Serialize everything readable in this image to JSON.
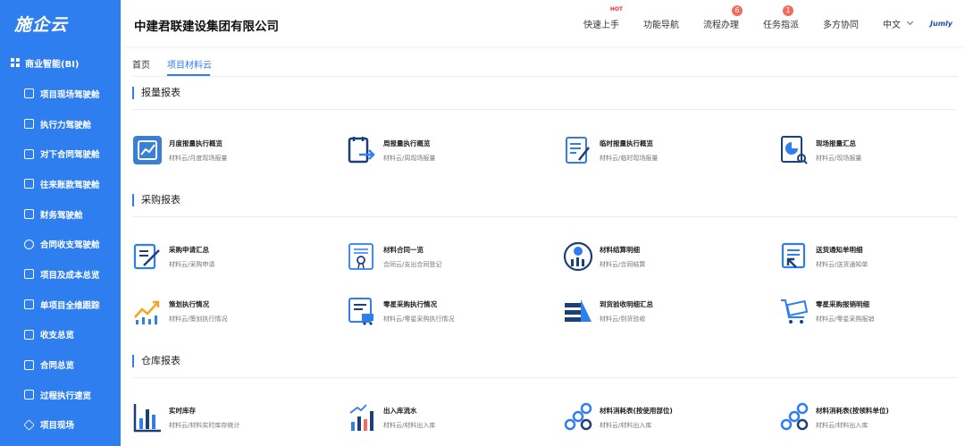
{
  "sidebar": {
    "logo": "施企云",
    "head": "商业智能(BI)",
    "items": [
      "项目现场驾驶舱",
      "执行力驾驶舱",
      "对下合同驾驶舱",
      "往来账款驾驶舱",
      "财务驾驶舱",
      "合同收支驾驶舱",
      "项目及成本总览",
      "单项目全维跟踪",
      "收支总览",
      "合同总览",
      "过程执行速览",
      "项目现场"
    ]
  },
  "header": {
    "company": "中建君联建设集团有限公司",
    "nav": {
      "quickstart": "快速上手",
      "quickstart_tag": "HOT",
      "funcnav": "功能导航",
      "process": "流程办理",
      "process_badge": "6",
      "task": "任务指派",
      "task_badge": "1",
      "collab": "多方协同",
      "lang": "中文",
      "brand": "Jumly"
    }
  },
  "tabs": [
    "首页",
    "项目材料云"
  ],
  "sections": [
    {
      "title": "报量报表",
      "cards": [
        {
          "title": "月度报量执行概览",
          "sub": "材料云/月度现场报量"
        },
        {
          "title": "周报量执行概览",
          "sub": "材料云/周现场报量"
        },
        {
          "title": "临时报量执行概览",
          "sub": "材料云/临时现场报量"
        },
        {
          "title": "现场报量汇总",
          "sub": "材料云/现场报量"
        }
      ]
    },
    {
      "title": "采购报表",
      "cards": [
        {
          "title": "采购申请汇总",
          "sub": "材料云/采购申请"
        },
        {
          "title": "材料合同一览",
          "sub": "合同云/支出合同登记"
        },
        {
          "title": "材料结算明细",
          "sub": "材料云/合同结算"
        },
        {
          "title": "送货通知单明细",
          "sub": "材料云/送货通知单"
        },
        {
          "title": "策划执行情况",
          "sub": "材料云/策划执行情况"
        },
        {
          "title": "零星采购执行情况",
          "sub": "材料云/零星采购执行情况"
        },
        {
          "title": "到货验收明细汇总",
          "sub": "材料云/到货验收"
        },
        {
          "title": "零星采购报销明细",
          "sub": "材料云/零星采购报销"
        }
      ]
    },
    {
      "title": "仓库报表",
      "cards": [
        {
          "title": "实时库存",
          "sub": "材料云/材料实时库存统计"
        },
        {
          "title": "出入库流水",
          "sub": "材料云/材料出入库"
        },
        {
          "title": "材料消耗表(按使用部位)",
          "sub": "材料云/材料出入库"
        },
        {
          "title": "材料消耗表(按领料单位)",
          "sub": "材料云/材料出入库"
        }
      ]
    }
  ]
}
